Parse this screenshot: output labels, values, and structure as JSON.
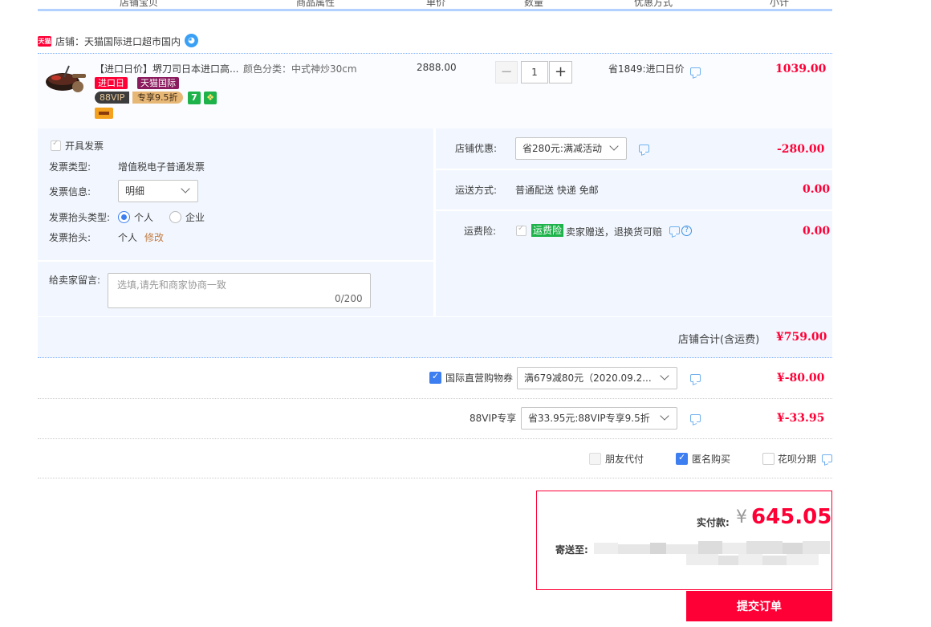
{
  "header": {
    "columns": [
      "店铺宝贝",
      "商品属性",
      "单价",
      "数量",
      "优惠方式",
      "小计"
    ]
  },
  "shop": {
    "logo_text": "天猫",
    "name": "店铺：天猫国际进口超市国内"
  },
  "item": {
    "title": "【进口日价】堺刀司日本进口高...",
    "tags": {
      "import_day": "进口日",
      "tmall_intl": "天猫国际",
      "vip": "88VIP",
      "vip_discount": "专享9.5折",
      "seven": "7"
    },
    "attribute": "颜色分类：中式神炒30cm",
    "unit_price": "2888.00",
    "quantity": "1",
    "minus": "−",
    "plus": "+",
    "discount": "省1849:进口日价",
    "subtotal": "1039.00"
  },
  "invoice": {
    "checkbox_label": "开具发票",
    "type_label": "发票类型:",
    "type_value": "增值税电子普通发票",
    "info_label": "发票信息:",
    "info_value": "明细",
    "header_type_label": "发票抬头类型:",
    "personal": "个人",
    "company": "企业",
    "header_label": "发票抬头:",
    "header_value": "个人",
    "edit": "修改"
  },
  "memo": {
    "label": "给卖家留言:",
    "placeholder": "选填,请先和商家协商一致",
    "count": "0/200"
  },
  "shop_discount": {
    "label": "店铺优惠:",
    "value": "省280元:满减活动",
    "amount": "-280.00"
  },
  "shipping": {
    "label": "运送方式:",
    "value": "普通配送 快递 免邮",
    "amount": "0.00"
  },
  "insurance": {
    "label": "运费险:",
    "tag": "运费险",
    "text": "卖家赠送，退换货可赔",
    "amount": "0.00"
  },
  "shop_total": {
    "label": "店铺合计(含运费)",
    "amount": "¥759.00"
  },
  "coupon": {
    "label": "国际直营购物券",
    "value": "满679减80元（2020.09.2...",
    "amount": "¥-80.00"
  },
  "vip88": {
    "label": "88VIP专享",
    "value": "省33.95元:88VIP专享9.5折",
    "amount": "¥-33.95"
  },
  "options": {
    "friend_pay": "朋友代付",
    "anonymous": "匿名购买",
    "huabei": "花呗分期"
  },
  "payment": {
    "label": "实付款:",
    "currency": "¥",
    "amount": "645.05",
    "ship_to_label": "寄送至:"
  },
  "submit_label": "提交订单",
  "colors": {
    "accent_red": "#ff0036",
    "light_blue_bg": "#f2f7ff",
    "checkbox_blue": "#3d7ef0"
  }
}
